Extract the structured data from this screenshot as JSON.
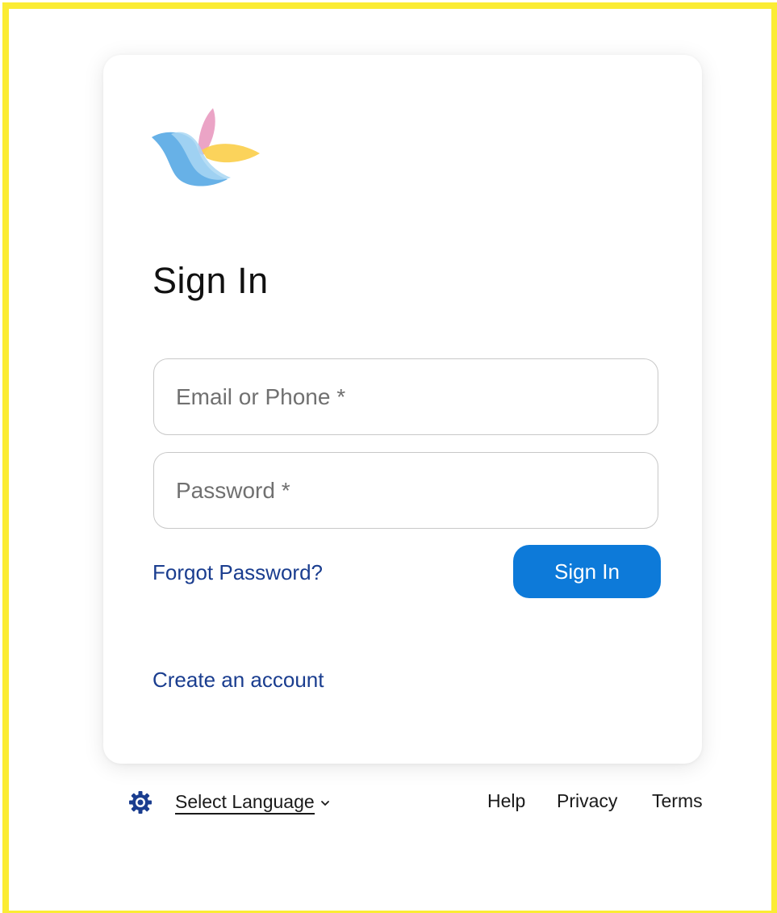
{
  "page": {
    "title": "Sign In"
  },
  "form": {
    "email": {
      "value": "",
      "placeholder": "Email or Phone *"
    },
    "password": {
      "value": "",
      "placeholder": "Password *"
    },
    "forgot_label": "Forgot Password?",
    "submit_label": "Sign In",
    "create_label": "Create an account"
  },
  "footer": {
    "language_label": "Select Language",
    "links": [
      "Help",
      "Privacy",
      "Terms"
    ]
  },
  "colors": {
    "frame": "#fbec34",
    "primary_button": "#0d7ad9",
    "link": "#1a3d8f",
    "gear_icon": "#1a3d8f"
  },
  "icons": {
    "logo": "pinwheel-leaf-logo",
    "settings": "gear-icon",
    "language_dropdown": "chevron-down-icon"
  }
}
